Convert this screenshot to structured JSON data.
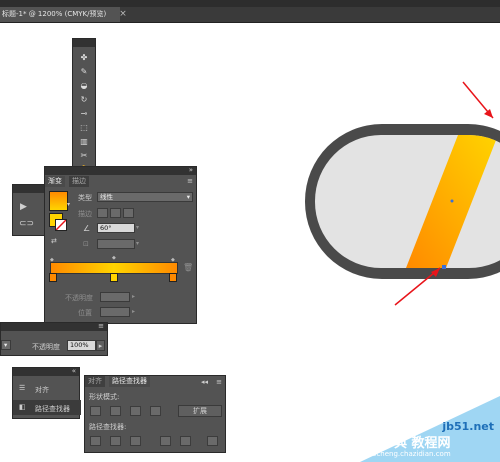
{
  "document": {
    "tab_title": "标题-1* @ 1200% (CMYK/预览)",
    "close_glyph": "×"
  },
  "tools_panel": {
    "icons": [
      "puppet-warp-icon",
      "brush-icon",
      "shape-builder-icon",
      "rotate-icon",
      "width-icon",
      "free-transform-icon",
      "chart-icon",
      "slice-icon",
      "hand-icon"
    ]
  },
  "gradient_panel": {
    "tab_gradient": "渐变",
    "tab_stroke": "描边",
    "type_label": "类型",
    "type_value": "线性",
    "stroke_label": "描边",
    "angle_value": "60°",
    "opacity_label": "不透明度",
    "location_label": "位置",
    "colors": {
      "start": "#ff8a00",
      "end": "#ffd400"
    }
  },
  "appearance_bar": {
    "opacity_label": "不透明度",
    "opacity_value": "100%"
  },
  "align_panel": {
    "align_label": "对齐",
    "pathfinder_label": "路径查找器"
  },
  "pathfinder_panel": {
    "tab_align": "对齐",
    "tab_pathfinder": "路径查找器",
    "shape_modes_label": "形状模式:",
    "pathfinders_label": "路径查找器:",
    "expand_label": "扩展"
  },
  "canvas": {
    "capsule_outer": "#4a4a4a",
    "capsule_inner": "#e3e3e3",
    "stripe_start": "#ff8a00",
    "stripe_end": "#ffd400",
    "arrow_color": "#e8141a"
  },
  "watermark": {
    "site": "jb51.net",
    "brand": "查字典 教程网",
    "url": "jiaocheng.chazidian.com"
  }
}
